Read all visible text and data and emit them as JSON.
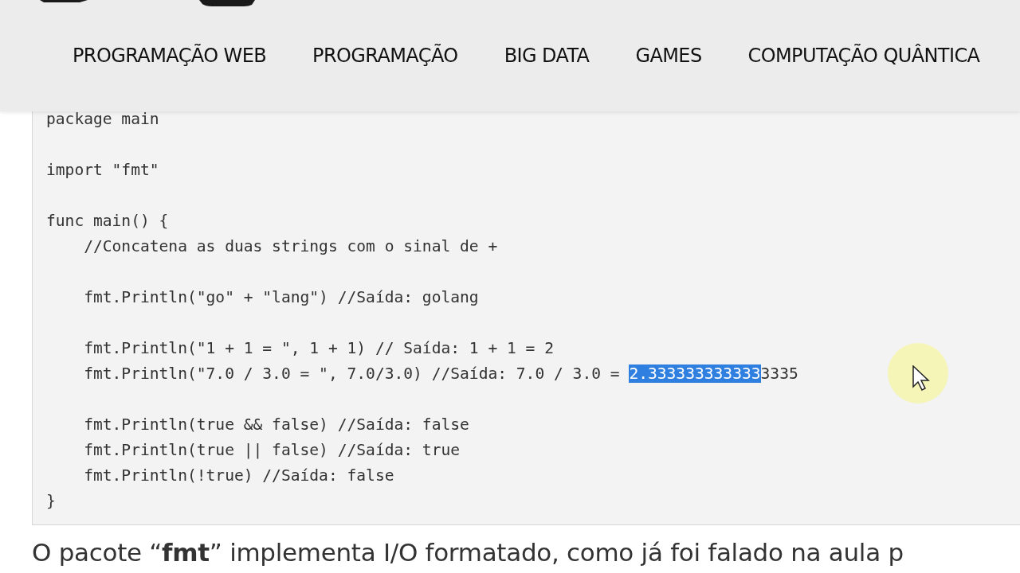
{
  "nav": {
    "items": [
      {
        "label": "PROGRAMAÇÃO WEB"
      },
      {
        "label": "PROGRAMAÇÃO"
      },
      {
        "label": "BIG DATA"
      },
      {
        "label": "GAMES"
      },
      {
        "label": "COMPUTAÇÃO QUÂNTICA"
      }
    ]
  },
  "code_block": {
    "lines": [
      {
        "kind": "code",
        "text": "package main"
      },
      {
        "kind": "blank"
      },
      {
        "kind": "code",
        "text": "import \"fmt\""
      },
      {
        "kind": "blank"
      },
      {
        "kind": "code",
        "text": "func main() {"
      },
      {
        "kind": "code",
        "text": "    //Concatena as duas strings com o sinal de +"
      },
      {
        "kind": "blank"
      },
      {
        "kind": "code",
        "text": "    fmt.Println(\"go\" + \"lang\") //Saída: golang"
      },
      {
        "kind": "blank"
      },
      {
        "kind": "code",
        "text": "    fmt.Println(\"1 + 1 = \", 1 + 1) // Saída: 1 + 1 = 2"
      },
      {
        "kind": "selection",
        "segments": [
          {
            "text": "    fmt.Println(\"7.0 / 3.0 = \", 7.0/3.0) //Saída: 7.0 / 3.0 = ",
            "selected": false
          },
          {
            "text": "2.333333333333",
            "selected": true
          },
          {
            "text": "3335",
            "selected": false
          }
        ]
      },
      {
        "kind": "blank"
      },
      {
        "kind": "code",
        "text": "    fmt.Println(true && false) //Saída: false"
      },
      {
        "kind": "code",
        "text": "    fmt.Println(true || false) //Saída: true"
      },
      {
        "kind": "code",
        "text": "    fmt.Println(!true) //Saída: false"
      },
      {
        "kind": "code",
        "text": "}"
      }
    ]
  },
  "paragraph": "O pacote “**fmt**” implementa I/O formatado, como já foi falado na aula p"
}
